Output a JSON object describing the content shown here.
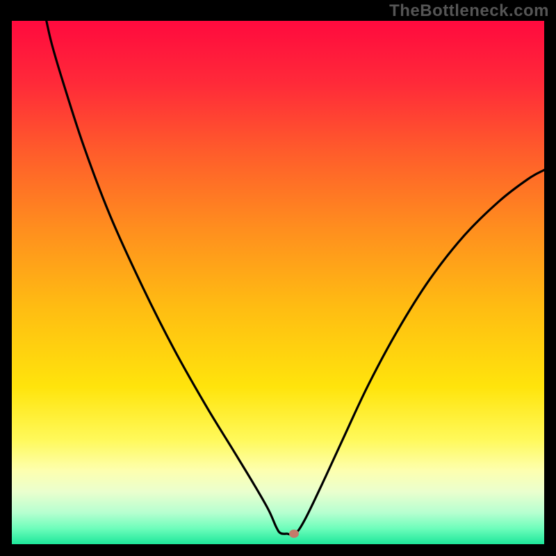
{
  "watermark": "TheBottleneck.com",
  "chart_data": {
    "type": "line",
    "title": "",
    "xlabel": "",
    "ylabel": "",
    "xlim": [
      0,
      100
    ],
    "ylim": [
      0,
      100
    ],
    "note": "V-shaped bottleneck curve over vertical rainbow gradient (red-orange-yellow-green). Minimum near x≈52, y≈2. Small marker dot at the minimum. Values estimated from pixel positions; no axis ticks or labels shown.",
    "curve": {
      "left_branch": [
        {
          "x": 6.5,
          "y": 100
        },
        {
          "x": 7.5,
          "y": 95.6
        },
        {
          "x": 9.5,
          "y": 88.7
        },
        {
          "x": 13.5,
          "y": 76.1
        },
        {
          "x": 18.5,
          "y": 62.7
        },
        {
          "x": 24.5,
          "y": 49.3
        },
        {
          "x": 30.5,
          "y": 37.2
        },
        {
          "x": 36.5,
          "y": 26.4
        },
        {
          "x": 41.5,
          "y": 18.1
        },
        {
          "x": 45.5,
          "y": 11.4
        },
        {
          "x": 48.2,
          "y": 6.6
        },
        {
          "x": 49.7,
          "y": 3.2
        },
        {
          "x": 50.5,
          "y": 2.1
        },
        {
          "x": 51.7,
          "y": 2.0
        }
      ],
      "right_branch": [
        {
          "x": 51.7,
          "y": 2.0
        },
        {
          "x": 53.2,
          "y": 2.0
        },
        {
          "x": 55.0,
          "y": 4.6
        },
        {
          "x": 58.2,
          "y": 11.3
        },
        {
          "x": 62.2,
          "y": 20.1
        },
        {
          "x": 67.0,
          "y": 30.5
        },
        {
          "x": 72.5,
          "y": 40.9
        },
        {
          "x": 78.5,
          "y": 50.6
        },
        {
          "x": 85.0,
          "y": 59.0
        },
        {
          "x": 91.5,
          "y": 65.5
        },
        {
          "x": 97.0,
          "y": 69.8
        },
        {
          "x": 100.0,
          "y": 71.5
        }
      ]
    },
    "marker": {
      "x": 53.0,
      "y": 2.0
    }
  },
  "gradient_stops": [
    {
      "offset": 0,
      "color": "#ff0a3e"
    },
    {
      "offset": 12,
      "color": "#ff2a39"
    },
    {
      "offset": 25,
      "color": "#ff5c2b"
    },
    {
      "offset": 40,
      "color": "#ff8f1e"
    },
    {
      "offset": 55,
      "color": "#ffbd12"
    },
    {
      "offset": 70,
      "color": "#ffe40c"
    },
    {
      "offset": 80,
      "color": "#fff95a"
    },
    {
      "offset": 86,
      "color": "#fdffb0"
    },
    {
      "offset": 90,
      "color": "#eaffce"
    },
    {
      "offset": 94,
      "color": "#b6ffd0"
    },
    {
      "offset": 97,
      "color": "#6dfdbb"
    },
    {
      "offset": 100,
      "color": "#1de79a"
    }
  ],
  "marker_color": "#c47a6a",
  "curve_color": "#000000"
}
